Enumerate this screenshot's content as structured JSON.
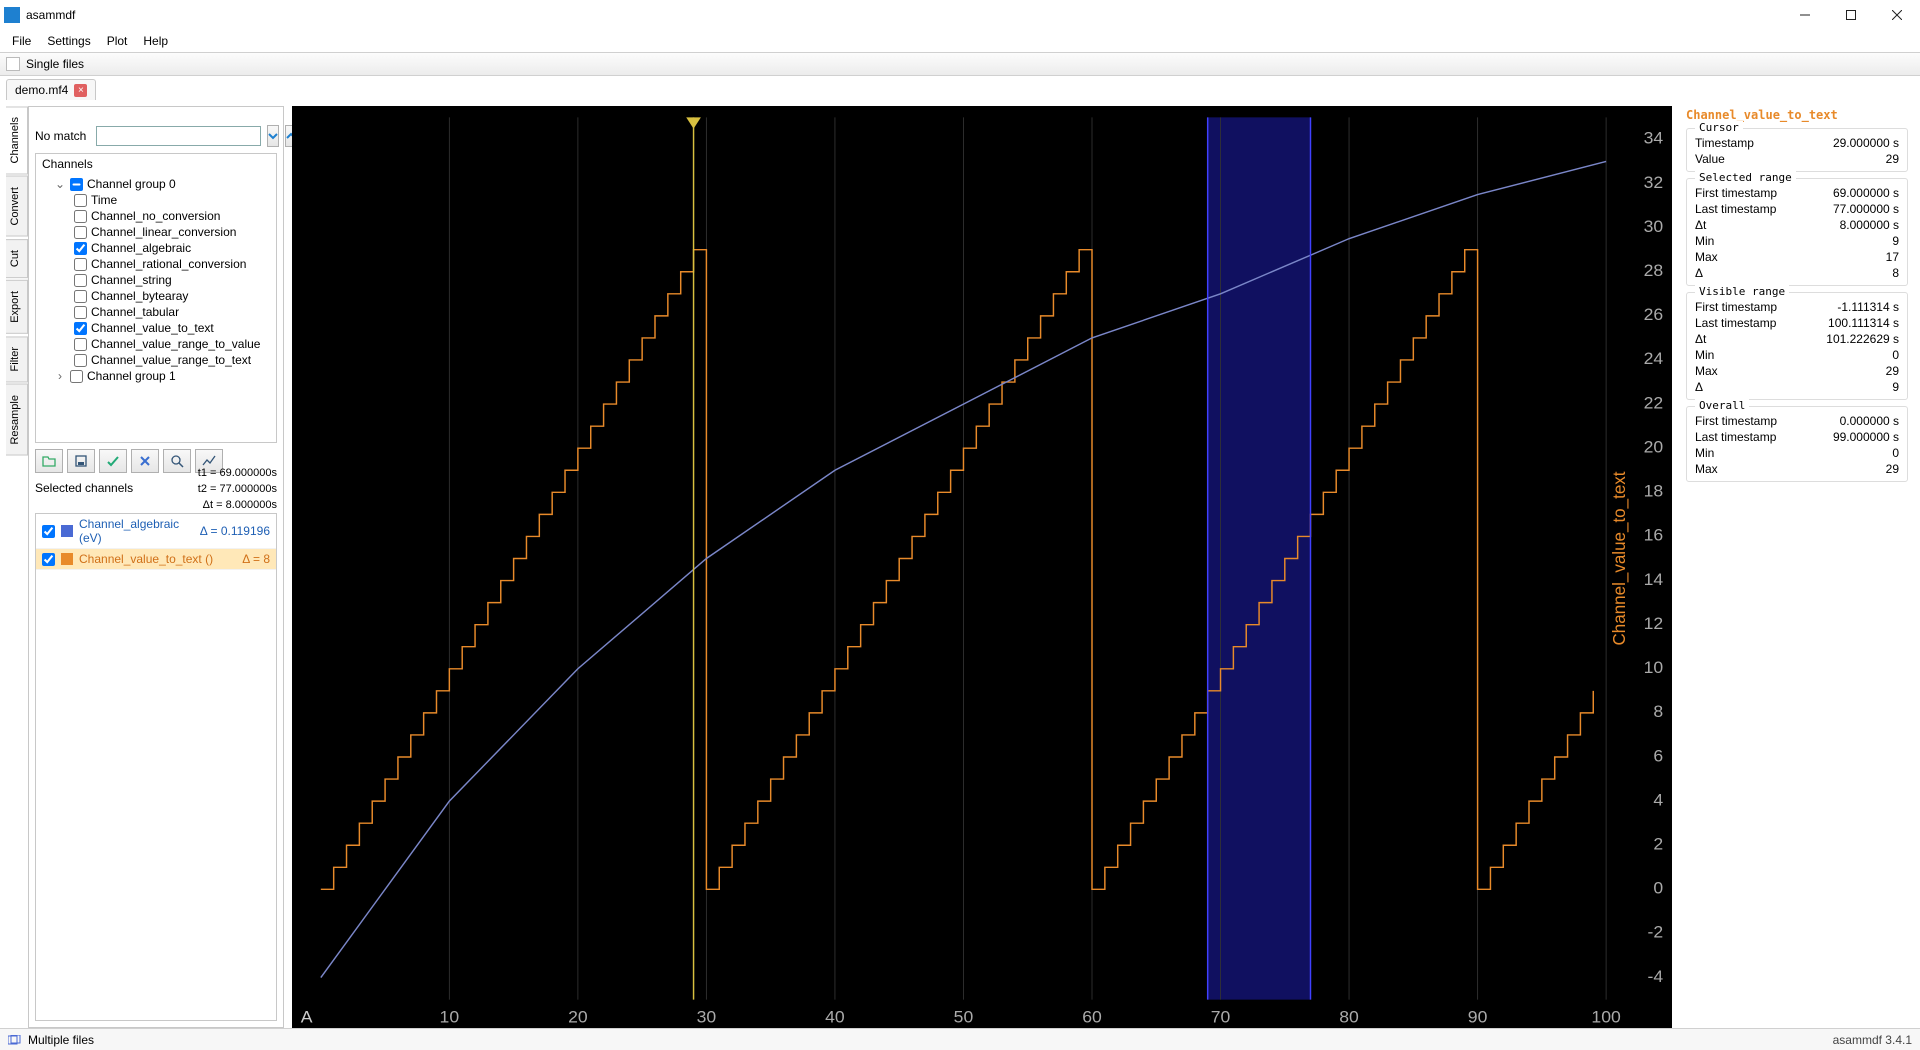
{
  "app": {
    "title": "asammdf"
  },
  "menubar": [
    "File",
    "Settings",
    "Plot",
    "Help"
  ],
  "toolstrip": {
    "label": "Single files"
  },
  "file_tabs": [
    {
      "name": "demo.mf4"
    }
  ],
  "vtabs": [
    "Channels",
    "Convert",
    "Cut",
    "Export",
    "Filter",
    "Resample"
  ],
  "search": {
    "label": "No match",
    "value": ""
  },
  "tree": {
    "header": "Channels",
    "groups": [
      {
        "name": "Channel group 0",
        "expanded": true,
        "state": "partial",
        "children": [
          {
            "name": "Time",
            "checked": false
          },
          {
            "name": "Channel_no_conversion",
            "checked": false
          },
          {
            "name": "Channel_linear_conversion",
            "checked": false
          },
          {
            "name": "Channel_algebraic",
            "checked": true
          },
          {
            "name": "Channel_rational_conversion",
            "checked": false
          },
          {
            "name": "Channel_string",
            "checked": false
          },
          {
            "name": "Channel_bytearay",
            "checked": false
          },
          {
            "name": "Channel_tabular",
            "checked": false
          },
          {
            "name": "Channel_value_to_text",
            "checked": true
          },
          {
            "name": "Channel_value_range_to_value",
            "checked": false
          },
          {
            "name": "Channel_value_range_to_text",
            "checked": false
          }
        ]
      },
      {
        "name": "Channel group 1",
        "expanded": false,
        "state": "unchecked",
        "children": []
      }
    ]
  },
  "time_info": {
    "t1": "t1 = 69.000000s",
    "t2": "t2 = 77.000000s",
    "dt": "Δt = 8.000000s"
  },
  "selected_channels_label": "Selected channels",
  "selected_channels": [
    {
      "color": "#4a6ad4",
      "name": "Channel_algebraic (eV)",
      "delta": "Δ = 0.119196",
      "checked": true
    },
    {
      "color": "#e88a2a",
      "name": "Channel_value_to_text ()",
      "delta": "Δ = 8",
      "checked": true,
      "selected": true
    }
  ],
  "right": {
    "title": "Channel_value_to_text",
    "groups": [
      {
        "legend": "Cursor",
        "rows": [
          [
            "Timestamp",
            "29.000000 s"
          ],
          [
            "Value",
            "29"
          ]
        ]
      },
      {
        "legend": "Selected range",
        "rows": [
          [
            "First timestamp",
            "69.000000 s"
          ],
          [
            "Last timestamp",
            "77.000000 s"
          ],
          [
            "Δt",
            "8.000000 s"
          ],
          [
            "Min",
            "9"
          ],
          [
            "Max",
            "17"
          ],
          [
            "Δ",
            "8"
          ]
        ]
      },
      {
        "legend": "Visible range",
        "rows": [
          [
            "First timestamp",
            "-1.111314 s"
          ],
          [
            "Last timestamp",
            "100.111314 s"
          ],
          [
            "Δt",
            "101.222629 s"
          ],
          [
            "Min",
            "0"
          ],
          [
            "Max",
            "29"
          ],
          [
            "Δ",
            "9"
          ]
        ]
      },
      {
        "legend": "Overall",
        "rows": [
          [
            "First timestamp",
            "0.000000 s"
          ],
          [
            "Last timestamp",
            "99.000000 s"
          ],
          [
            "Min",
            "0"
          ],
          [
            "Max",
            "29"
          ]
        ]
      }
    ]
  },
  "statusbar": {
    "left": "Multiple files",
    "right": "asammdf 3.4.1"
  },
  "chart_data": {
    "type": "line",
    "title": "",
    "xlabel": "",
    "ylabel": "Channel_value_to_text",
    "x_ticks": [
      10,
      20,
      30,
      40,
      50,
      60,
      70,
      80,
      90,
      100
    ],
    "y_ticks": [
      -4,
      -2,
      0,
      2,
      4,
      6,
      8,
      10,
      12,
      14,
      16,
      18,
      20,
      22,
      24,
      26,
      28,
      30,
      32,
      34
    ],
    "xlim": [
      -1.1,
      100.1
    ],
    "ylim": [
      -5,
      35
    ],
    "cursor_x": 29,
    "selection_x": [
      69,
      77
    ],
    "series": [
      {
        "name": "Channel_value_to_text",
        "color": "#e88a2a",
        "style": "step",
        "x": [
          0,
          1,
          2,
          3,
          4,
          5,
          6,
          7,
          8,
          9,
          10,
          11,
          12,
          13,
          14,
          15,
          16,
          17,
          18,
          19,
          20,
          21,
          22,
          23,
          24,
          25,
          26,
          27,
          28,
          29,
          30,
          31,
          32,
          33,
          34,
          35,
          36,
          37,
          38,
          39,
          40,
          41,
          42,
          43,
          44,
          45,
          46,
          47,
          48,
          49,
          50,
          51,
          52,
          53,
          54,
          55,
          56,
          57,
          58,
          59,
          60,
          61,
          62,
          63,
          64,
          65,
          66,
          67,
          68,
          69,
          70,
          71,
          72,
          73,
          74,
          75,
          76,
          77,
          78,
          79,
          80,
          81,
          82,
          83,
          84,
          85,
          86,
          87,
          88,
          89,
          90,
          91,
          92,
          93,
          94,
          95,
          96,
          97,
          98,
          99
        ],
        "values": [
          0,
          1,
          2,
          3,
          4,
          5,
          6,
          7,
          8,
          9,
          10,
          11,
          12,
          13,
          14,
          15,
          16,
          17,
          18,
          19,
          20,
          21,
          22,
          23,
          24,
          25,
          26,
          27,
          28,
          29,
          0,
          1,
          2,
          3,
          4,
          5,
          6,
          7,
          8,
          9,
          10,
          11,
          12,
          13,
          14,
          15,
          16,
          17,
          18,
          19,
          20,
          21,
          22,
          23,
          24,
          25,
          26,
          27,
          28,
          29,
          0,
          1,
          2,
          3,
          4,
          5,
          6,
          7,
          8,
          9,
          10,
          11,
          12,
          13,
          14,
          15,
          16,
          17,
          18,
          19,
          20,
          21,
          22,
          23,
          24,
          25,
          26,
          27,
          28,
          29,
          0,
          1,
          2,
          3,
          4,
          5,
          6,
          7,
          8,
          9
        ]
      },
      {
        "name": "Channel_algebraic",
        "color": "#7a86c8",
        "style": "line",
        "note": "curved line roughly log-like from bottom-left to top-right on its own axis; approximate trace shown",
        "x": [
          0,
          10,
          20,
          30,
          40,
          50,
          60,
          70,
          80,
          90,
          100
        ],
        "values": [
          -4,
          4,
          10,
          15,
          19,
          22,
          25,
          27,
          29.5,
          31.5,
          33
        ]
      }
    ]
  }
}
